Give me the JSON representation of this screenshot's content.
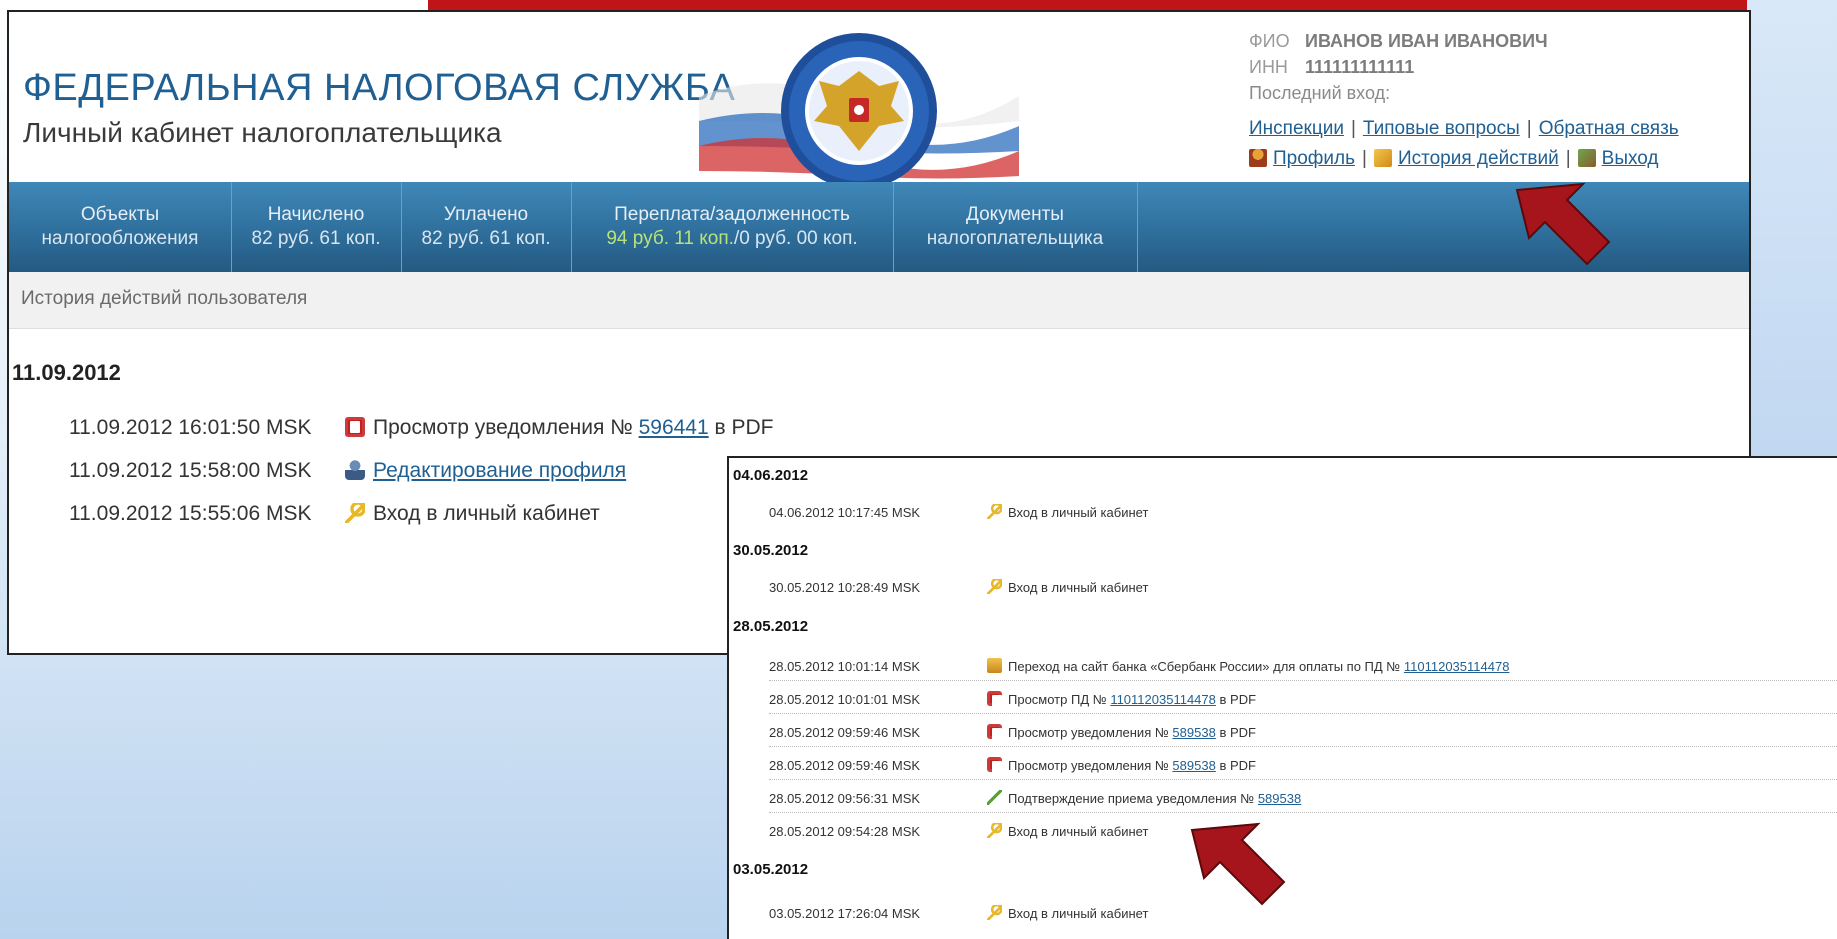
{
  "header": {
    "title": "ФЕДЕРАЛЬНАЯ НАЛОГОВАЯ СЛУЖБА",
    "subtitle": "Личный кабинет налогоплательщика"
  },
  "user": {
    "fio_label": "ФИО",
    "fio_value": "ИВАНОВ ИВАН ИВАНОВИЧ",
    "inn_label": "ИНН",
    "inn_value": "111111111111",
    "last_login_label": "Последний вход:"
  },
  "links": {
    "inspections": "Инспекции",
    "faq": "Типовые вопросы",
    "feedback": "Обратная связь",
    "profile": "Профиль",
    "history": "История действий",
    "exit": "Выход"
  },
  "nav": [
    {
      "line1": "Объекты",
      "line2": "налогообложения"
    },
    {
      "line1": "Начислено",
      "line2": "82 руб. 61 коп."
    },
    {
      "line1": "Уплачено",
      "line2": "82 руб. 61 коп."
    },
    {
      "line1": "Переплата/задолженность",
      "line2a": "94 руб. 11 коп.",
      "line2b": "/0 руб. 00 коп."
    },
    {
      "line1": "Документы",
      "line2": "налогоплательщика"
    }
  ],
  "breadcrumb": "История действий пользователя",
  "main_history": {
    "date": "11.09.2012",
    "rows": [
      {
        "ts": "11.09.2012 16:01:50 MSK",
        "pre": "Просмотр уведомления №",
        "link": "596441",
        "post": "в PDF"
      },
      {
        "ts": "11.09.2012 15:58:00 MSK",
        "link": "Редактирование профиля"
      },
      {
        "ts": "11.09.2012 15:55:06 MSK",
        "pre": "Вход в личный кабинет"
      }
    ]
  },
  "overlay_history": {
    "groups": [
      {
        "date": "04.06.2012",
        "rows": [
          {
            "ts": "04.06.2012 10:17:45 MSK",
            "pre": "Вход в личный кабинет"
          }
        ]
      },
      {
        "date": "30.05.2012",
        "rows": [
          {
            "ts": "30.05.2012 10:28:49 MSK",
            "pre": "Вход в личный кабинет"
          }
        ]
      },
      {
        "date": "28.05.2012",
        "rows": [
          {
            "ts": "28.05.2012 10:01:14 MSK",
            "pre": "Переход на сайт банка «Сбербанк России» для оплаты по ПД №",
            "link": "110112035114478"
          },
          {
            "ts": "28.05.2012 10:01:01 MSK",
            "pre": "Просмотр ПД №",
            "link": "110112035114478",
            "post": "в PDF"
          },
          {
            "ts": "28.05.2012 09:59:46 MSK",
            "pre": "Просмотр уведомления №",
            "link": "589538",
            "post": "в PDF"
          },
          {
            "ts": "28.05.2012 09:59:46 MSK",
            "pre": "Просмотр уведомления №",
            "link": "589538",
            "post": "в PDF"
          },
          {
            "ts": "28.05.2012 09:56:31 MSK",
            "pre": "Подтверждение приема уведомления №",
            "link": "589538"
          },
          {
            "ts": "28.05.2012 09:54:28 MSK",
            "pre": "Вход в личный кабинет"
          }
        ]
      },
      {
        "date": "03.05.2012",
        "rows": [
          {
            "ts": "03.05.2012 17:26:04 MSK",
            "pre": "Вход в личный кабинет"
          }
        ]
      }
    ]
  },
  "colors": {
    "brand_blue": "#1f5f92",
    "nav_blue": "#2f6f9c",
    "arrow_red": "#a5151b",
    "green_amount": "#b8e27a"
  }
}
